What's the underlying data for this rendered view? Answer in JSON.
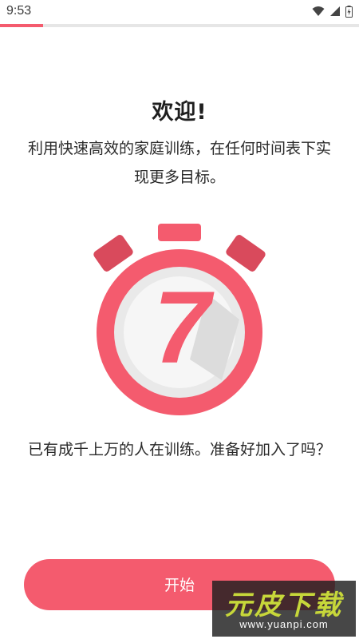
{
  "status_bar": {
    "time": "9:53",
    "icons": [
      "wifi-icon",
      "signal-icon",
      "battery-icon"
    ]
  },
  "onboarding": {
    "progress": 0.12,
    "title": "欢迎!",
    "subtitle": "利用快速高效的家庭训练，在任何时间表下实现更多目标。",
    "illustration_glyph": "7",
    "bottom_text": "已有成千上万的人在训练。准备好加入了吗？",
    "start_button_label": "开始"
  },
  "watermark": {
    "main": "元皮下载",
    "url": "www.yuanpi.com"
  },
  "colors": {
    "accent": "#f45b6e",
    "accent_dark": "#d94a5c",
    "watch_face": "#e9e9e9",
    "watch_center": "#f6f6f6"
  }
}
